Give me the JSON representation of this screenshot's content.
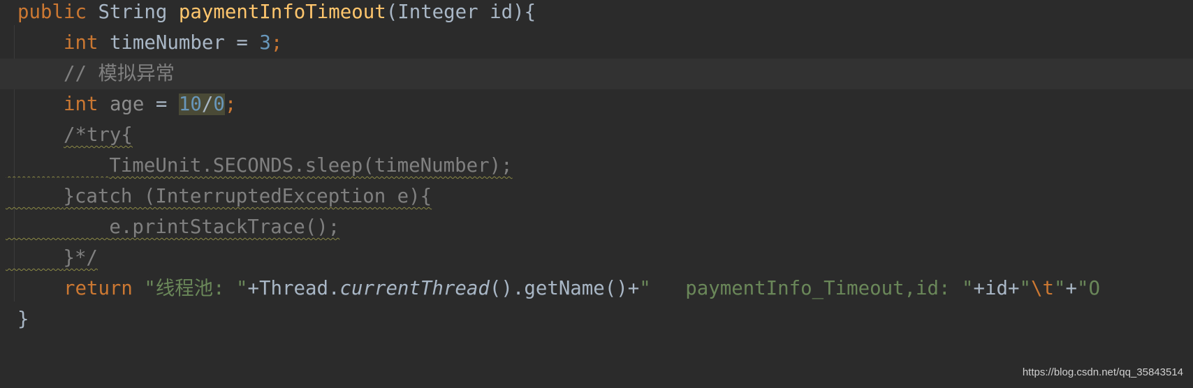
{
  "editor": {
    "current_line": 2,
    "lines": [
      {
        "indent": 0,
        "tokens": [
          {
            "text": "public ",
            "kind": "kw"
          },
          {
            "text": "String ",
            "kind": "plain"
          },
          {
            "text": "paymentInfoTimeout",
            "kind": "method"
          },
          {
            "text": "(Integer id){",
            "kind": "plain"
          }
        ]
      },
      {
        "indent": 4,
        "tokens": [
          {
            "text": "int ",
            "kind": "kw"
          },
          {
            "text": "timeNumber = ",
            "kind": "plain"
          },
          {
            "text": "3",
            "kind": "num"
          },
          {
            "text": ";",
            "kind": "kw"
          }
        ]
      },
      {
        "indent": 4,
        "tokens": [
          {
            "text": "// 模拟异常",
            "kind": "comment"
          }
        ]
      },
      {
        "indent": 4,
        "tokens": [
          {
            "text": "int ",
            "kind": "kw"
          },
          {
            "text": "age",
            "kind": "unused"
          },
          {
            "text": " = ",
            "kind": "plain"
          },
          {
            "text": "10",
            "kind": "num hl"
          },
          {
            "text": "/",
            "kind": "plain hl"
          },
          {
            "text": "0",
            "kind": "num hl"
          },
          {
            "text": ";",
            "kind": "kw"
          }
        ]
      },
      {
        "indent": 4,
        "tokens": [
          {
            "text": "/*try{",
            "kind": "block"
          }
        ]
      },
      {
        "indent": 8,
        "wavy_lead": true,
        "tokens": [
          {
            "text": "TimeUnit.SECONDS.sleep(timeNumber);",
            "kind": "block"
          }
        ]
      },
      {
        "indent": 4,
        "wavy_lead": true,
        "tokens": [
          {
            "text": "}catch (InterruptedException e){",
            "kind": "block"
          }
        ]
      },
      {
        "indent": 8,
        "wavy_lead": true,
        "tokens": [
          {
            "text": "e.printStackTrace();",
            "kind": "block"
          }
        ]
      },
      {
        "indent": 4,
        "wavy_lead": true,
        "tokens": [
          {
            "text": "}*/",
            "kind": "block"
          }
        ]
      },
      {
        "indent": 4,
        "tokens": [
          {
            "text": "return ",
            "kind": "kw"
          },
          {
            "text": "\"线程池: \"",
            "kind": "str"
          },
          {
            "text": "+Thread.",
            "kind": "plain"
          },
          {
            "text": "currentThread",
            "kind": "italic"
          },
          {
            "text": "().getName()+",
            "kind": "plain"
          },
          {
            "text": "\"   paymentInfo_Timeout,id: \"",
            "kind": "str"
          },
          {
            "text": "+id+",
            "kind": "plain"
          },
          {
            "text": "\"",
            "kind": "str"
          },
          {
            "text": "\\t",
            "kind": "esc"
          },
          {
            "text": "\"",
            "kind": "str"
          },
          {
            "text": "+",
            "kind": "plain"
          },
          {
            "text": "\"O",
            "kind": "str"
          }
        ]
      },
      {
        "indent": 0,
        "tokens": [
          {
            "text": "}",
            "kind": "plain"
          }
        ]
      }
    ]
  },
  "watermark": "https://blog.csdn.net/qq_35843514",
  "colors": {
    "background": "#2b2b2b",
    "current_line": "#323232",
    "keyword": "#cc7832",
    "identifier": "#a9b7c6",
    "method": "#ffc66d",
    "number": "#6897bb",
    "comment": "#808080",
    "string": "#6a8759"
  }
}
